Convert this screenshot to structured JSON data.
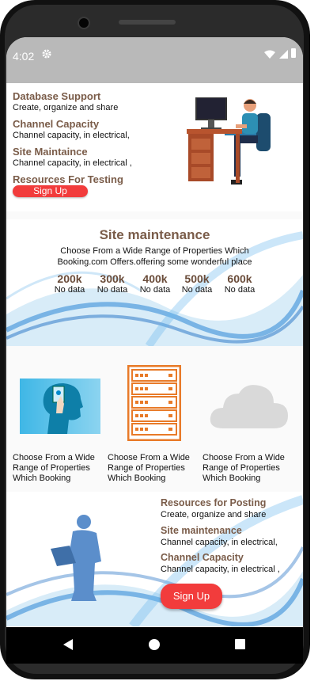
{
  "status_bar": {
    "time": "4:02"
  },
  "features": [
    {
      "title": "Database Support",
      "text": "Create, organize and share"
    },
    {
      "title": "Channel Capacity",
      "text": "Channel capacity, in electrical,"
    },
    {
      "title": "Site Maintaince",
      "text": "Channel capacity, in electrical ,"
    },
    {
      "title": "Resources For Testing"
    }
  ],
  "signup_small_label": "Sign Up",
  "stats_section": {
    "title": "Site maintenance",
    "desc_line1": "Choose From a Wide Range of Properties Which",
    "desc_line2": "Booking.com Offers.offering some wonderful place",
    "stats": [
      {
        "value": "200k",
        "label": "No data"
      },
      {
        "value": "300k",
        "label": "No data"
      },
      {
        "value": "400k",
        "label": "No data"
      },
      {
        "value": "500k",
        "label": "No data"
      },
      {
        "value": "600k",
        "label": "No data"
      }
    ]
  },
  "cards": [
    {
      "icon": "touch-head-icon",
      "text": "Choose From a Wide Range of Properties Which Booking"
    },
    {
      "icon": "server-rack-icon",
      "text": "Choose From a Wide Range of Properties Which Booking"
    },
    {
      "icon": "cloud-icon",
      "text": "Choose From a Wide Range of Properties Which Booking"
    }
  ],
  "posting": [
    {
      "title": "Resources for Posting",
      "text": "Create, organize and share"
    },
    {
      "title": "Site maintenance",
      "text": "Channel capacity, in electrical,"
    },
    {
      "title": "Channel Capacity",
      "text": "Channel capacity, in electrical ,"
    }
  ],
  "signup_big_label": "Sign Up",
  "colors": {
    "accent": "#f23c3c",
    "heading": "#7a5c49",
    "statusbar": "#b9b9b9"
  }
}
